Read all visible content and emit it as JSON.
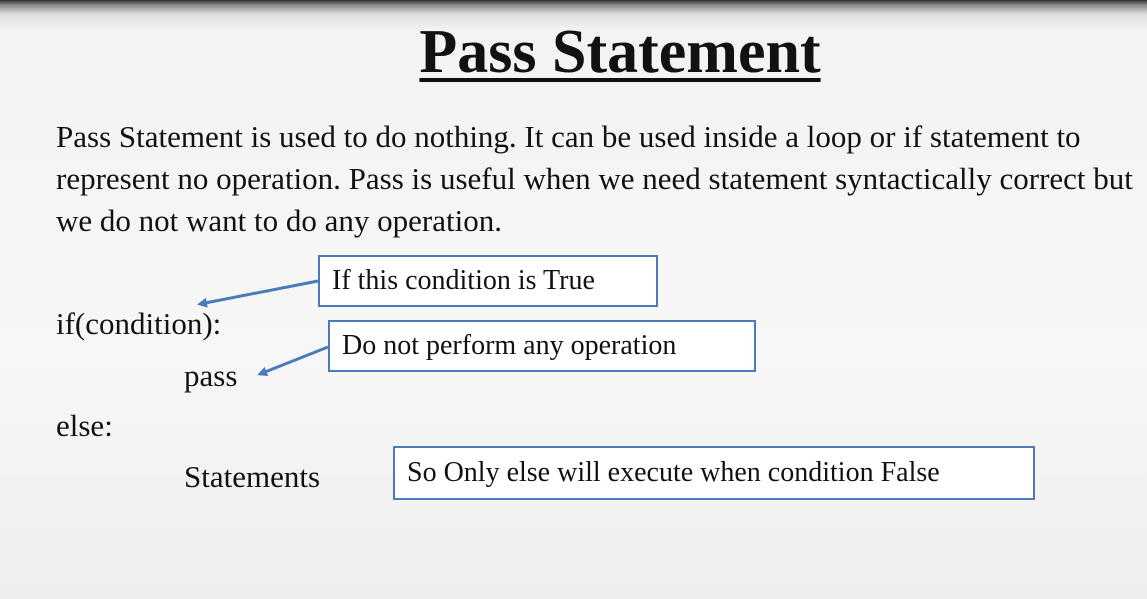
{
  "slide": {
    "title": "Pass Statement",
    "description": "Pass Statement is used to do nothing. It can be used inside a loop or if statement to represent no operation. Pass is useful when we need statement syntactically correct but we do not want to do any operation.",
    "code": {
      "if_line": "if(condition):",
      "pass_line": "pass",
      "else_line": "else:",
      "statements_line": "Statements"
    },
    "callouts": {
      "condition_true": "If this condition is True",
      "no_operation": "Do not perform any operation",
      "else_executes": "So Only else will execute when condition False"
    }
  },
  "colors": {
    "callout_border": "#4a7ab8",
    "arrow": "#4a7ab8",
    "text": "#111111"
  }
}
